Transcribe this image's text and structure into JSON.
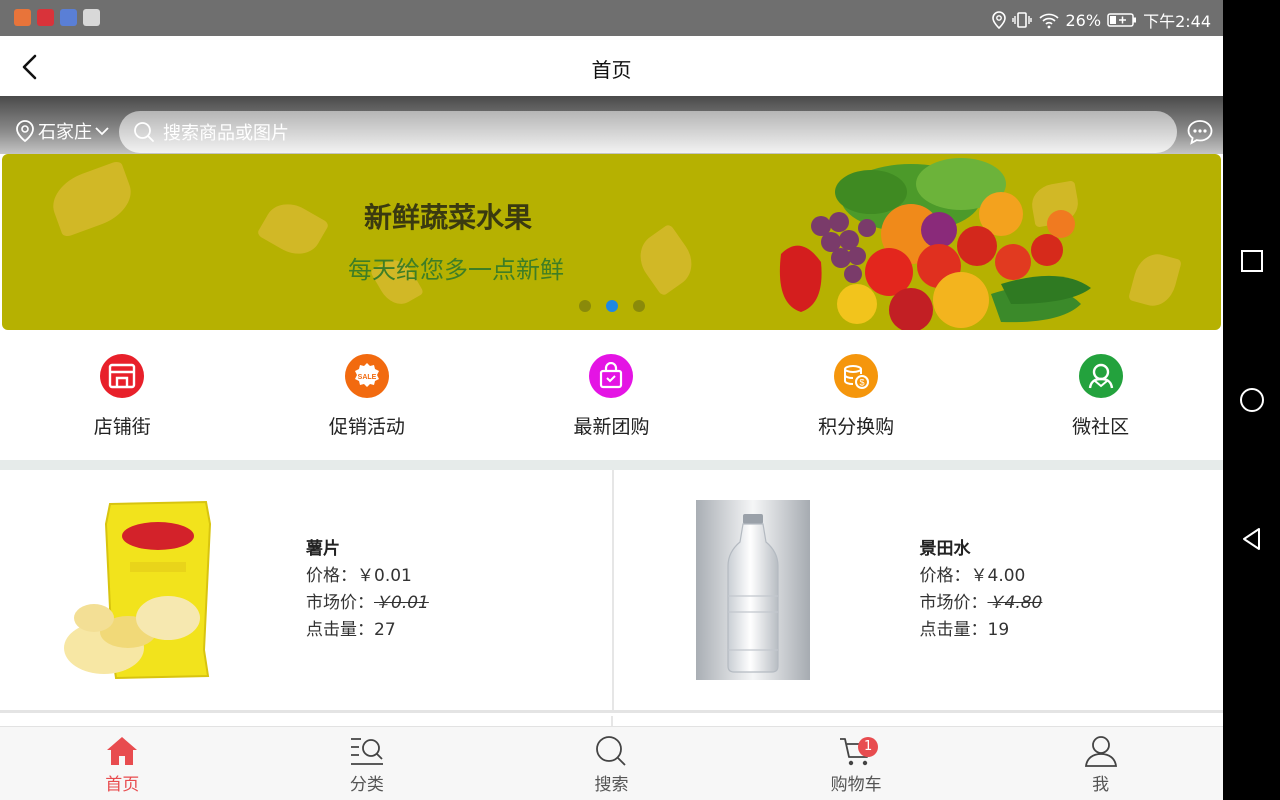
{
  "status_bar": {
    "battery_percent": "26%",
    "time": "下午2:44"
  },
  "header": {
    "title": "首页"
  },
  "search": {
    "city": "石家庄",
    "placeholder": "搜索商品或图片"
  },
  "banner": {
    "title": "新鲜蔬菜水果",
    "subtitle": "每天给您多一点新鲜",
    "slide_count": 3,
    "active_slide": 2
  },
  "quick_menu": [
    {
      "label": "店铺街",
      "icon": "storefront-icon",
      "color": "#e8202a"
    },
    {
      "label": "促销活动",
      "icon": "sale-badge-icon",
      "color": "#f26a0f"
    },
    {
      "label": "最新团购",
      "icon": "shopping-bag-icon",
      "color": "#e414e4"
    },
    {
      "label": "积分换购",
      "icon": "coins-icon",
      "color": "#f5960c"
    },
    {
      "label": "微社区",
      "icon": "community-icon",
      "color": "#23a23d"
    }
  ],
  "products": [
    {
      "name": "薯片",
      "price_label": "价格：",
      "price": "￥0.01",
      "market_label": "市场价：",
      "market_price": "￥0.01",
      "clicks_label": "点击量：",
      "clicks": "27",
      "image": "potato-chips-bag"
    },
    {
      "name": "景田水",
      "price_label": "价格：",
      "price": "￥4.00",
      "market_label": "市场价：",
      "market_price": "￥4.80",
      "clicks_label": "点击量：",
      "clicks": "19",
      "image": "water-bottle"
    }
  ],
  "tabbar": [
    {
      "label": "首页",
      "icon": "home-icon",
      "active": true
    },
    {
      "label": "分类",
      "icon": "category-search-icon",
      "active": false
    },
    {
      "label": "搜索",
      "icon": "search-icon",
      "active": false
    },
    {
      "label": "购物车",
      "icon": "cart-icon",
      "active": false,
      "badge": "1"
    },
    {
      "label": "我",
      "icon": "user-icon",
      "active": false
    }
  ],
  "colors": {
    "accent": "#e84c4f",
    "banner_bg": "#b6b101",
    "active_dot": "#1e88e5"
  }
}
